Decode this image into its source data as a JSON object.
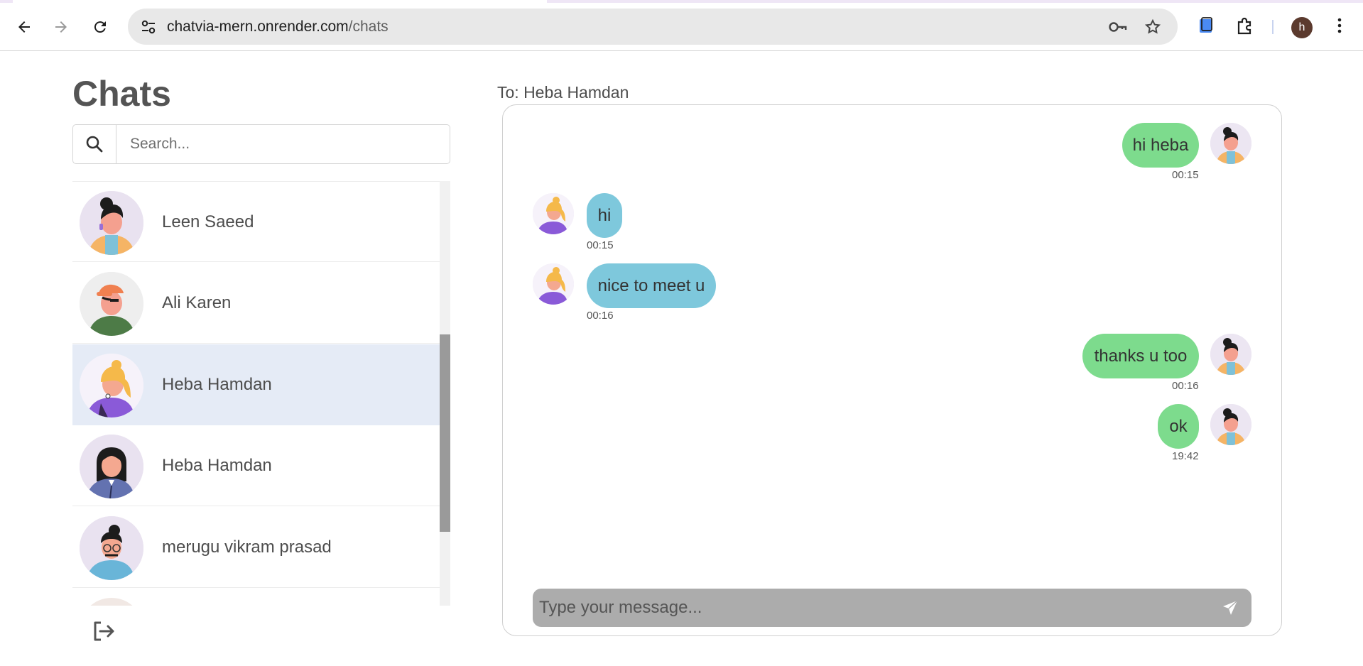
{
  "browser": {
    "url_host": "chatvia-mern.onrender.com",
    "url_path": "/chats",
    "profile_initial": "h",
    "icons": [
      "back-icon",
      "forward-icon",
      "reload-icon",
      "site-settings-icon",
      "password-key-icon",
      "bookmark-star-icon",
      "tab-search-icon",
      "extensions-icon",
      "menu-icon"
    ]
  },
  "sidebar": {
    "title": "Chats",
    "search_placeholder": "Search...",
    "chats": [
      {
        "name": "Leen Saeed",
        "avatar": "woman-bun-avatar",
        "selected": false
      },
      {
        "name": "Ali Karen",
        "avatar": "man-cap-avatar",
        "selected": false
      },
      {
        "name": "Heba Hamdan",
        "avatar": "woman-blonde-avatar",
        "selected": true
      },
      {
        "name": "Heba Hamdan",
        "avatar": "woman-dark-hair-avatar",
        "selected": false
      },
      {
        "name": "merugu vikram prasad",
        "avatar": "man-glasses-avatar",
        "selected": false
      }
    ]
  },
  "conversation": {
    "to_label": "To: Heba Hamdan",
    "messages": [
      {
        "text": "hi heba",
        "time": "00:15",
        "from": "me"
      },
      {
        "text": "hi",
        "time": "00:15",
        "from": "them"
      },
      {
        "text": "nice to meet u",
        "time": "00:16",
        "from": "them"
      },
      {
        "text": "thanks u too",
        "time": "00:16",
        "from": "me"
      },
      {
        "text": "ok",
        "time": "19:42",
        "from": "me"
      }
    ],
    "compose_placeholder": "Type your message..."
  },
  "colors": {
    "my_bubble": "#7ddb8d",
    "their_bubble": "#7ec8dc",
    "selected_chat": "#e5ebf6",
    "compose_bar": "#acacac"
  }
}
